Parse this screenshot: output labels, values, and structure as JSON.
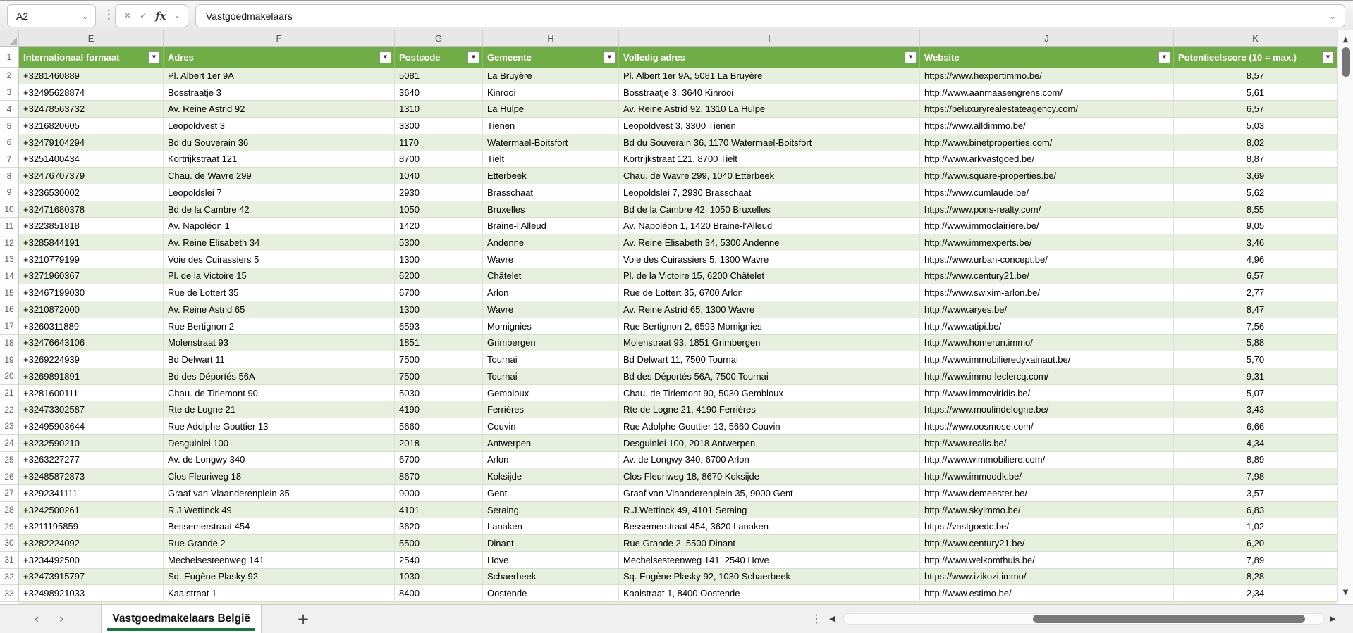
{
  "formula_bar": {
    "name_box": "A2",
    "formula": "Vastgoedmakelaars"
  },
  "icons": {
    "name_box_chevron": "⌄",
    "cancel": "✕",
    "check": "✓",
    "fx": "fx",
    "fx_chevron": "⌄",
    "formula_chevron": "⌄",
    "filter_arrow": "▼",
    "prev": "‹",
    "next": "›",
    "add": "+",
    "kebab": "⋮",
    "hscroll_left": "◀",
    "hscroll_right": "▶",
    "vscroll_up": "▲",
    "vscroll_down": "▼"
  },
  "colors": {
    "header_green": "#70ad47",
    "band_green": "#e7f0de",
    "tab_underline_green": "#1e7145"
  },
  "grid": {
    "column_letters": [
      "E",
      "F",
      "G",
      "H",
      "I",
      "J",
      "K"
    ],
    "header_row_number": "1",
    "headers": [
      "Internationaal formaat",
      "Adres",
      "Postcode",
      "Gemeente",
      "Volledig adres",
      "Website",
      "Potentieelscore (10 = max.)"
    ],
    "rows": [
      {
        "n": "2",
        "cells": [
          "+3281460889",
          "Pl. Albert 1er 9A",
          "5081",
          "La Bruyère",
          "Pl. Albert 1er 9A, 5081 La Bruyère",
          "https://www.hexpertimmo.be/",
          "8,57"
        ]
      },
      {
        "n": "3",
        "cells": [
          "+32495628874",
          "Bosstraatje 3",
          "3640",
          "Kinrooi",
          "Bosstraatje 3, 3640 Kinrooi",
          "http://www.aanmaasengrens.com/",
          "5,61"
        ]
      },
      {
        "n": "4",
        "cells": [
          "+32478563732",
          "Av. Reine Astrid 92",
          "1310",
          "La Hulpe",
          "Av. Reine Astrid 92, 1310 La Hulpe",
          "https://beluxuryrealestateagency.com/",
          "6,57"
        ]
      },
      {
        "n": "5",
        "cells": [
          "+3216820605",
          "Leopoldvest 3",
          "3300",
          "Tienen",
          "Leopoldvest 3, 3300 Tienen",
          "https://www.alldimmo.be/",
          "5,03"
        ]
      },
      {
        "n": "6",
        "cells": [
          "+32479104294",
          "Bd du Souverain 36",
          "1170",
          "Watermael-Boitsfort",
          "Bd du Souverain 36, 1170 Watermael-Boitsfort",
          "http://www.binetproperties.com/",
          "8,02"
        ]
      },
      {
        "n": "7",
        "cells": [
          "+3251400434",
          "Kortrijkstraat 121",
          "8700",
          "Tielt",
          "Kortrijkstraat 121, 8700 Tielt",
          "http://www.arkvastgoed.be/",
          "8,87"
        ]
      },
      {
        "n": "8",
        "cells": [
          "+32476707379",
          "Chau. de Wavre 299",
          "1040",
          "Etterbeek",
          "Chau. de Wavre 299, 1040 Etterbeek",
          "http://www.square-properties.be/",
          "3,69"
        ]
      },
      {
        "n": "9",
        "cells": [
          "+3236530002",
          "Leopoldslei 7",
          "2930",
          "Brasschaat",
          "Leopoldslei 7, 2930 Brasschaat",
          "https://www.cumlaude.be/",
          "5,62"
        ]
      },
      {
        "n": "10",
        "cells": [
          "+32471680378",
          "Bd de la Cambre 42",
          "1050",
          "Bruxelles",
          "Bd de la Cambre 42, 1050 Bruxelles",
          "https://www.pons-realty.com/",
          "8,55"
        ]
      },
      {
        "n": "11",
        "cells": [
          "+3223851818",
          "Av. Napoléon 1",
          "1420",
          "Braine-l’Alleud",
          "Av. Napoléon 1, 1420 Braine-l’Alleud",
          "http://www.immoclairiere.be/",
          "9,05"
        ]
      },
      {
        "n": "12",
        "cells": [
          "+3285844191",
          "Av. Reine Elisabeth 34",
          "5300",
          "Andenne",
          "Av. Reine Elisabeth 34, 5300 Andenne",
          "http://www.immexperts.be/",
          "3,46"
        ]
      },
      {
        "n": "13",
        "cells": [
          "+3210779199",
          "Voie des Cuirassiers 5",
          "1300",
          "Wavre",
          "Voie des Cuirassiers 5, 1300 Wavre",
          "https://www.urban-concept.be/",
          "4,96"
        ]
      },
      {
        "n": "14",
        "cells": [
          "+3271960367",
          "Pl. de la Victoire 15",
          "6200",
          "Châtelet",
          "Pl. de la Victoire 15, 6200 Châtelet",
          "https://www.century21.be/",
          "6,57"
        ]
      },
      {
        "n": "15",
        "cells": [
          "+32467199030",
          "Rue de Lottert 35",
          "6700",
          "Arlon",
          "Rue de Lottert 35, 6700 Arlon",
          "https://www.swixim-arlon.be/",
          "2,77"
        ]
      },
      {
        "n": "16",
        "cells": [
          "+3210872000",
          "Av. Reine Astrid 65",
          "1300",
          "Wavre",
          "Av. Reine Astrid 65, 1300 Wavre",
          "http://www.aryes.be/",
          "8,47"
        ]
      },
      {
        "n": "17",
        "cells": [
          "+3260311889",
          "Rue Bertignon 2",
          "6593",
          "Momignies",
          "Rue Bertignon 2, 6593 Momignies",
          "http://www.atipi.be/",
          "7,56"
        ]
      },
      {
        "n": "18",
        "cells": [
          "+32476643106",
          "Molenstraat 93",
          "1851",
          "Grimbergen",
          "Molenstraat 93, 1851 Grimbergen",
          "http://www.homerun.immo/",
          "5,88"
        ]
      },
      {
        "n": "19",
        "cells": [
          "+3269224939",
          "Bd Delwart 11",
          "7500",
          "Tournai",
          "Bd Delwart 11, 7500 Tournai",
          "http://www.immobilieredухainaut.be/",
          "5,70"
        ]
      },
      {
        "n": "20",
        "cells": [
          "+3269891891",
          "Bd des Déportés 56A",
          "7500",
          "Tournai",
          "Bd des Déportés 56A, 7500 Tournai",
          "http://www.immo-leclercq.com/",
          "9,31"
        ]
      },
      {
        "n": "21",
        "cells": [
          "+3281600111",
          "Chau. de Tirlemont 90",
          "5030",
          "Gembloux",
          "Chau. de Tirlemont 90, 5030 Gembloux",
          "http://www.immoviridis.be/",
          "5,07"
        ]
      },
      {
        "n": "22",
        "cells": [
          "+32473302587",
          "Rte de Logne 21",
          "4190",
          "Ferrières",
          "Rte de Logne 21, 4190 Ferrières",
          "https://www.moulindelogne.be/",
          "3,43"
        ]
      },
      {
        "n": "23",
        "cells": [
          "+32495903644",
          "Rue Adolphe Gouttier 13",
          "5660",
          "Couvin",
          "Rue Adolphe Gouttier 13, 5660 Couvin",
          "https://www.oosmose.com/",
          "6,66"
        ]
      },
      {
        "n": "24",
        "cells": [
          "+3232590210",
          "Desguinlei 100",
          "2018",
          "Antwerpen",
          "Desguinlei 100, 2018 Antwerpen",
          "http://www.realis.be/",
          "4,34"
        ]
      },
      {
        "n": "25",
        "cells": [
          "+3263227277",
          "Av. de Longwy 340",
          "6700",
          "Arlon",
          "Av. de Longwy 340, 6700 Arlon",
          "http://www.wimmobiliere.com/",
          "8,89"
        ]
      },
      {
        "n": "26",
        "cells": [
          "+32485872873",
          "Clos Fleuriweg 18",
          "8670",
          "Koksijde",
          "Clos Fleuriweg 18, 8670 Koksijde",
          "http://www.immoodk.be/",
          "7,98"
        ]
      },
      {
        "n": "27",
        "cells": [
          "+3292341111",
          "Graaf van Vlaanderenplein 35",
          "9000",
          "Gent",
          "Graaf van Vlaanderenplein 35, 9000 Gent",
          "http://www.demeester.be/",
          "3,57"
        ]
      },
      {
        "n": "28",
        "cells": [
          "+3242500261",
          "R.J.Wettinck 49",
          "4101",
          "Seraing",
          "R.J.Wettinck 49, 4101 Seraing",
          "http://www.skyimmo.be/",
          "6,83"
        ]
      },
      {
        "n": "29",
        "cells": [
          "+3211195859",
          "Bessemerstraat 454",
          "3620",
          "Lanaken",
          "Bessemerstraat 454, 3620 Lanaken",
          "https://vastgoedc.be/",
          "1,02"
        ]
      },
      {
        "n": "30",
        "cells": [
          "+3282224092",
          "Rue Grande 2",
          "5500",
          "Dinant",
          "Rue Grande 2, 5500 Dinant",
          "http://www.century21.be/",
          "6,20"
        ]
      },
      {
        "n": "31",
        "cells": [
          "+3234492500",
          "Mechelsesteenweg 141",
          "2540",
          "Hove",
          "Mechelsesteenweg 141, 2540 Hove",
          "http://www.welkomthuis.be/",
          "7,89"
        ]
      },
      {
        "n": "32",
        "cells": [
          "+32473915797",
          "Sq. Eugène Plasky 92",
          "1030",
          "Schaerbeek",
          "Sq. Eugène Plasky 92, 1030 Schaerbeek",
          "https://www.izikozi.immo/",
          "8,28"
        ]
      },
      {
        "n": "33",
        "cells": [
          "+32498921033",
          "Kaaistraat 1",
          "8400",
          "Oostende",
          "Kaaistraat 1, 8400 Oostende",
          "http://www.estimo.be/",
          "2,34"
        ]
      }
    ]
  },
  "sheet_bar": {
    "tab_label": "Vastgoedmakelaars België"
  }
}
